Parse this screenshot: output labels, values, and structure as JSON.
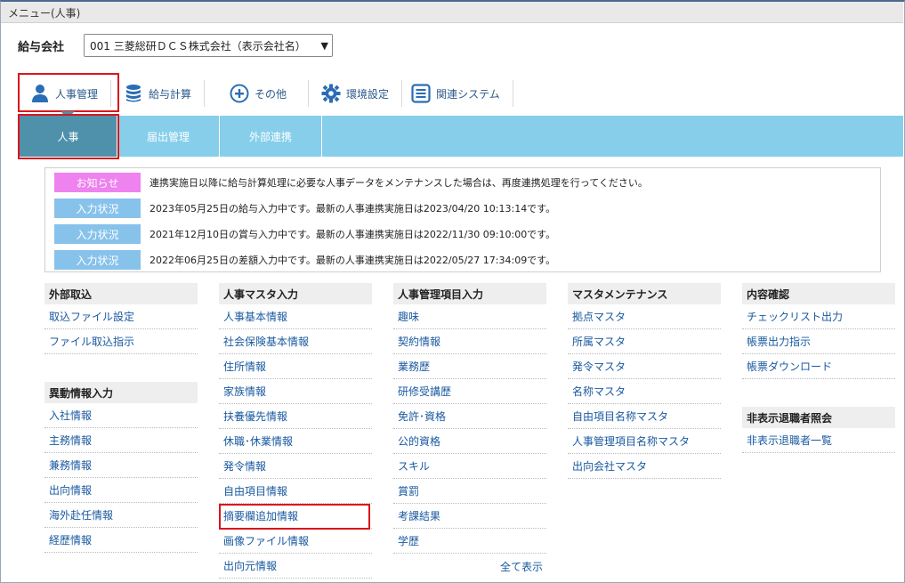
{
  "menu_title": "メニュー(人事)",
  "company": {
    "label": "給与会社",
    "selected": "001 三菱総研ＤＣＳ株式会社（表示会社名）"
  },
  "topnav": [
    {
      "label": "人事管理",
      "icon": "person-icon"
    },
    {
      "label": "給与計算",
      "icon": "database-icon"
    },
    {
      "label": "その他",
      "icon": "plus-circle-icon"
    },
    {
      "label": "環境設定",
      "icon": "gear-icon"
    },
    {
      "label": "関連システム",
      "icon": "list-icon"
    }
  ],
  "subnav": [
    "人事",
    "届出管理",
    "外部連携"
  ],
  "notices": [
    {
      "badge": "お知らせ",
      "text": "連携実施日以降に給与計算処理に必要な人事データをメンテナンスした場合は、再度連携処理を行ってください。"
    },
    {
      "badge": "入力状況",
      "text": "2023年05月25日の給与入力中です。最新の人事連携実施日は2023/04/20 10:13:14です。"
    },
    {
      "badge": "入力状況",
      "text": "2021年12月10日の賞与入力中です。最新の人事連携実施日は2022/11/30 09:10:00です。"
    },
    {
      "badge": "入力状況",
      "text": "2022年06月25日の差額入力中です。最新の人事連携実施日は2022/05/27 17:34:09です。"
    }
  ],
  "sections": {
    "external": {
      "title": "外部取込",
      "links": [
        "取込ファイル設定",
        "ファイル取込指示"
      ]
    },
    "transfer": {
      "title": "異動情報入力",
      "links": [
        "入社情報",
        "主務情報",
        "兼務情報",
        "出向情報",
        "海外赴任情報",
        "経歴情報"
      ]
    },
    "master_input": {
      "title": "人事マスタ入力",
      "links": [
        "人事基本情報",
        "社会保険基本情報",
        "住所情報",
        "家族情報",
        "扶養優先情報",
        "休職･休業情報",
        "発令情報",
        "自由項目情報",
        "摘要欄追加情報",
        "画像ファイル情報",
        "出向元情報"
      ]
    },
    "item_input": {
      "title": "人事管理項目入力",
      "links": [
        "趣味",
        "契約情報",
        "業務歴",
        "研修受講歴",
        "免許･資格",
        "公的資格",
        "スキル",
        "賞罰",
        "考課結果",
        "学歴"
      ],
      "show_all": "全て表示"
    },
    "maintenance": {
      "title": "マスタメンテナンス",
      "links": [
        "拠点マスタ",
        "所属マスタ",
        "発令マスタ",
        "名称マスタ",
        "自由項目名称マスタ",
        "人事管理項目名称マスタ",
        "出向会社マスタ"
      ]
    },
    "confirm": {
      "title": "内容確認",
      "links": [
        "チェックリスト出力",
        "帳票出力指示",
        "帳票ダウンロード"
      ]
    },
    "hidden_retiree": {
      "title": "非表示退職者照会",
      "links": [
        "非表示退職者一覧"
      ]
    }
  },
  "colors": {
    "accent_red": "#d9171c",
    "subnav_bg": "#87ceeb",
    "subnav_active": "#4f90ab",
    "link": "#1a5aa0"
  }
}
